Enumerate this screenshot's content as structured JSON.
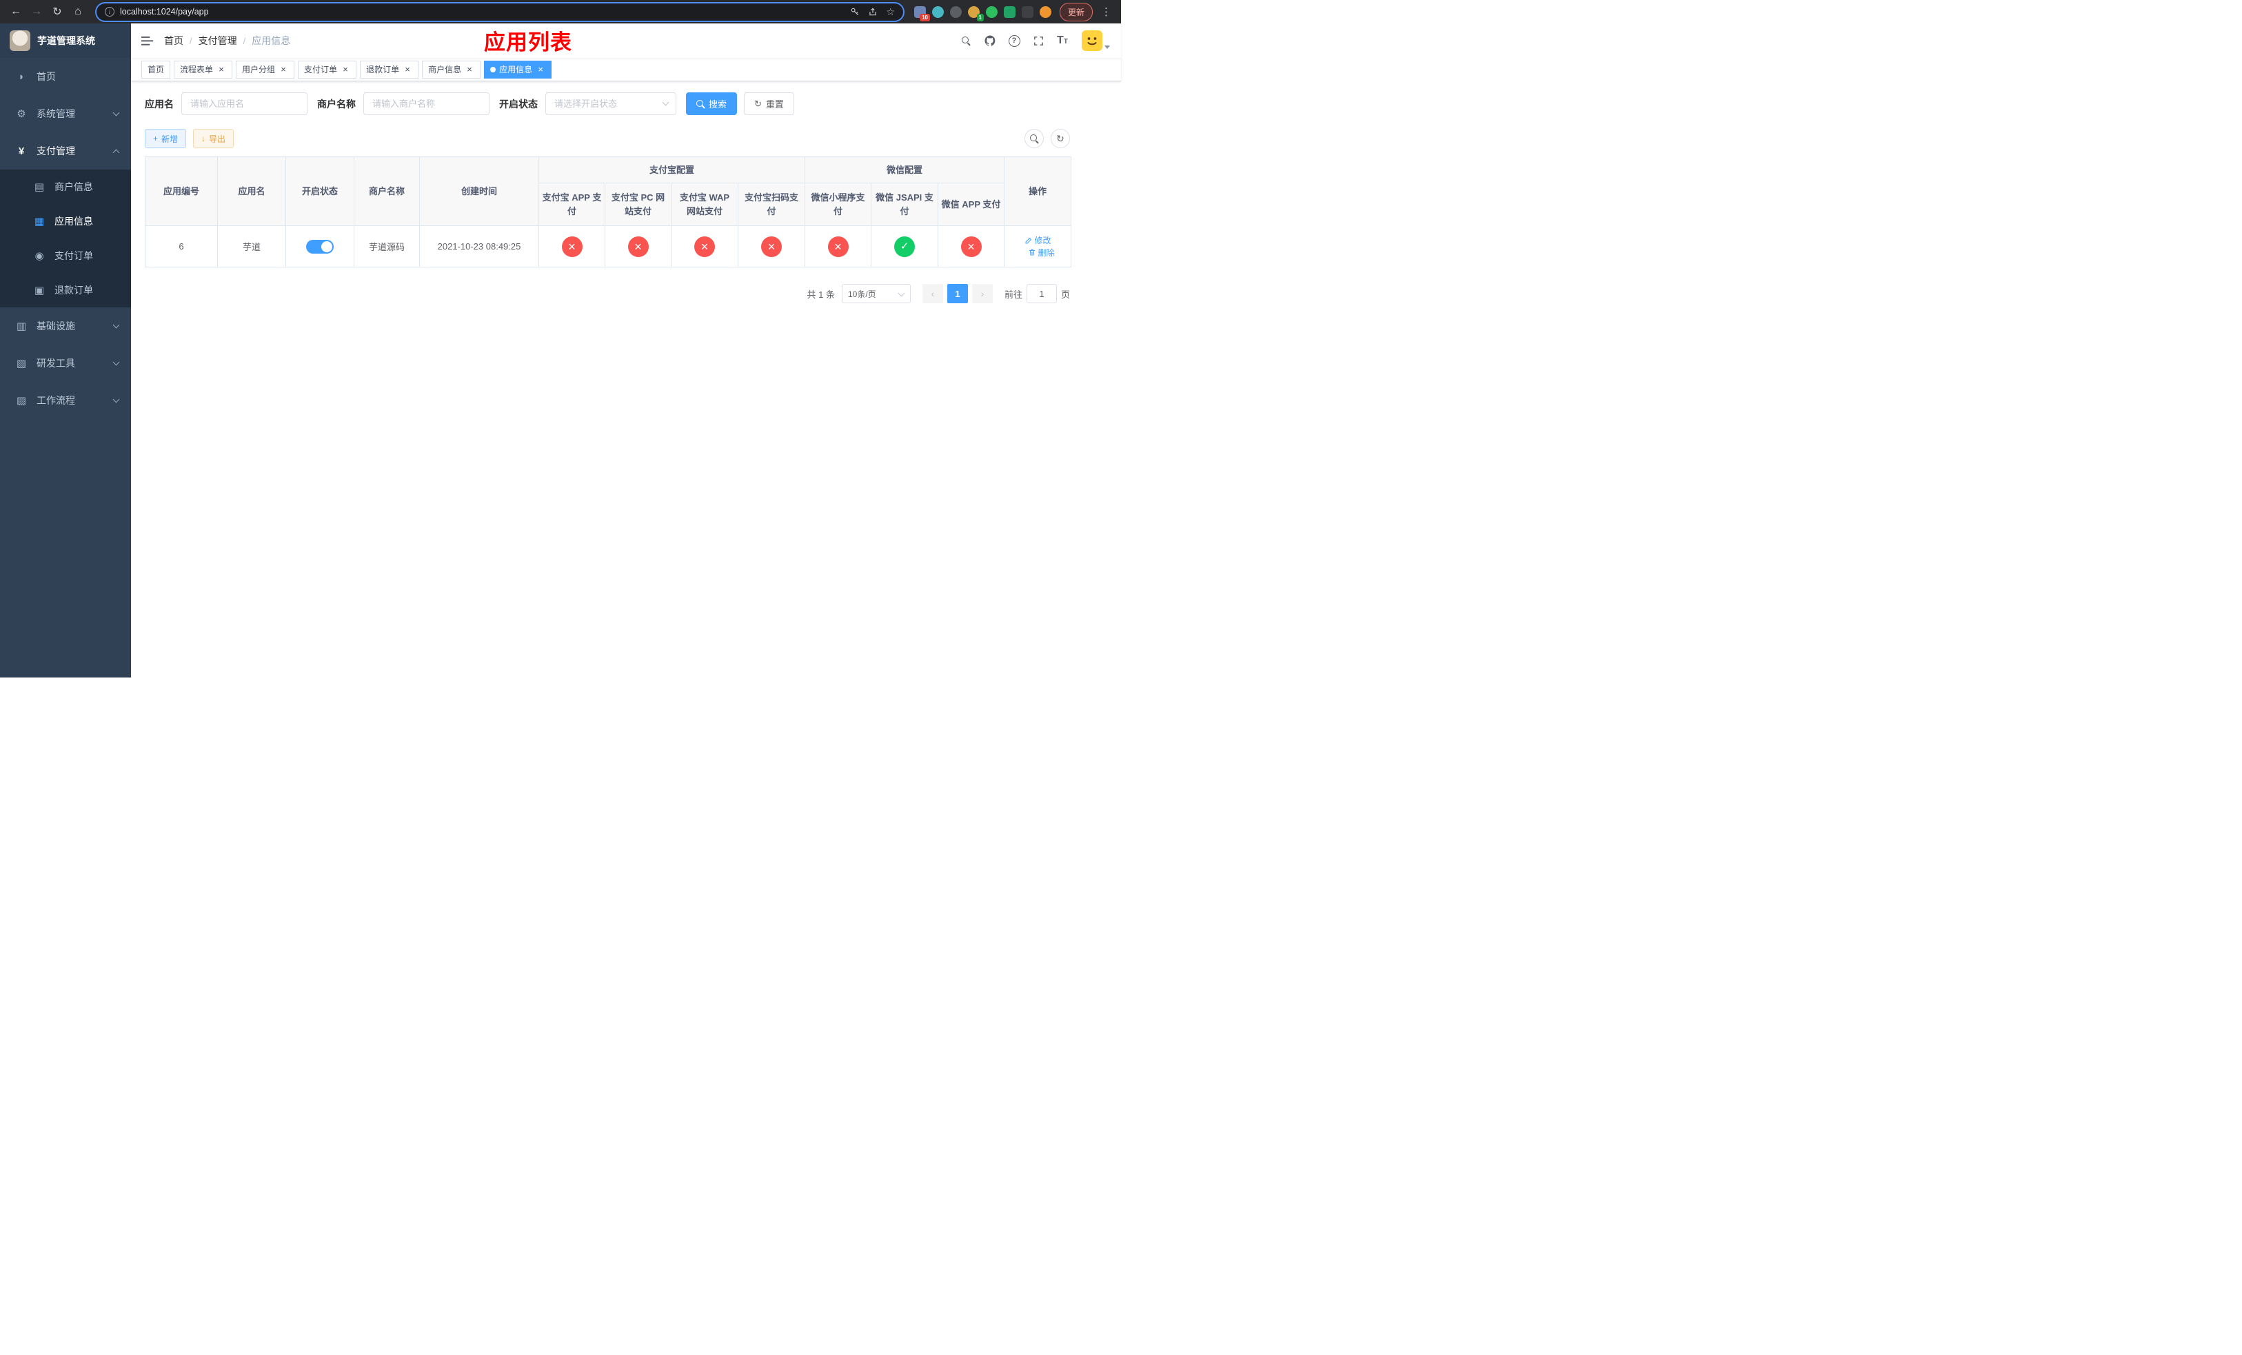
{
  "browser": {
    "url": "localhost:1024/pay/app",
    "update_label": "更新",
    "ext_badge_1": "10",
    "ext_badge_2": "1"
  },
  "app": {
    "title": "芋道管理系统"
  },
  "sidebar": {
    "menu": [
      {
        "label": "首页",
        "icon": "dashboard-icon"
      },
      {
        "label": "系统管理",
        "icon": "gear-icon",
        "expandable": true
      },
      {
        "label": "支付管理",
        "icon": "yen-icon",
        "expandable": true,
        "expanded": true,
        "children": [
          {
            "label": "商户信息",
            "icon": "bank-card-icon"
          },
          {
            "label": "应用信息",
            "icon": "app-grid-icon",
            "active": true
          },
          {
            "label": "支付订单",
            "icon": "pay-order-icon"
          },
          {
            "label": "退款订单",
            "icon": "refund-order-icon"
          }
        ]
      },
      {
        "label": "基础设施",
        "icon": "infrastructure-icon",
        "expandable": true
      },
      {
        "label": "研发工具",
        "icon": "dev-tools-icon",
        "expandable": true
      },
      {
        "label": "工作流程",
        "icon": "workflow-icon",
        "expandable": true
      }
    ]
  },
  "header": {
    "breadcrumb": [
      "首页",
      "支付管理",
      "应用信息"
    ],
    "annotation": "应用列表"
  },
  "tabs": [
    {
      "label": "首页",
      "closable": false,
      "active": false
    },
    {
      "label": "流程表单",
      "closable": true,
      "active": false
    },
    {
      "label": "用户分组",
      "closable": true,
      "active": false
    },
    {
      "label": "支付订单",
      "closable": true,
      "active": false
    },
    {
      "label": "退款订单",
      "closable": true,
      "active": false
    },
    {
      "label": "商户信息",
      "closable": true,
      "active": false
    },
    {
      "label": "应用信息",
      "closable": true,
      "active": true
    }
  ],
  "filters": {
    "app_name": {
      "label": "应用名",
      "placeholder": "请输入应用名",
      "value": ""
    },
    "merchant_name": {
      "label": "商户名称",
      "placeholder": "请输入商户名称",
      "value": ""
    },
    "status": {
      "label": "开启状态",
      "placeholder": "请选择开启状态",
      "value": ""
    },
    "search_label": "搜索",
    "reset_label": "重置"
  },
  "toolbar": {
    "add_label": "新增",
    "export_label": "导出"
  },
  "table": {
    "plain_columns": [
      "应用编号",
      "应用名",
      "开启状态",
      "商户名称",
      "创建时间"
    ],
    "alipay_group": {
      "title": "支付宝配置",
      "columns": [
        "支付宝 APP 支付",
        "支付宝 PC 网站支付",
        "支付宝 WAP 网站支付",
        "支付宝扫码支付"
      ]
    },
    "wechat_group": {
      "title": "微信配置",
      "columns": [
        "微信小程序支付",
        "微信 JSAPI 支付",
        "微信 APP 支付"
      ]
    },
    "actions_column": "操作",
    "rows": [
      {
        "app_id": "6",
        "app_name": "芋道",
        "status_enabled": true,
        "merchant_name": "芋道源码",
        "create_time": "2021-10-23 08:49:25",
        "alipay_app": "no",
        "alipay_pc": "no",
        "alipay_wap": "no",
        "alipay_scan": "no",
        "wechat_mini": "no",
        "wechat_jsapi": "yes",
        "wechat_app": "no",
        "edit_label": "修改",
        "delete_label": "删除"
      }
    ]
  },
  "pagination": {
    "total_text": "共 1 条",
    "page_size_text": "10条/页",
    "current_page": "1",
    "goto_prefix": "前往",
    "goto_value": "1",
    "goto_suffix": "页"
  },
  "colors": {
    "accent": "#409EFF",
    "danger": "#f9544f",
    "success": "#13ce66",
    "warning": "#e6a23c",
    "annotation": "#ff0000",
    "sidebar_bg": "#304156",
    "submenu_bg": "#1f2d3d"
  }
}
